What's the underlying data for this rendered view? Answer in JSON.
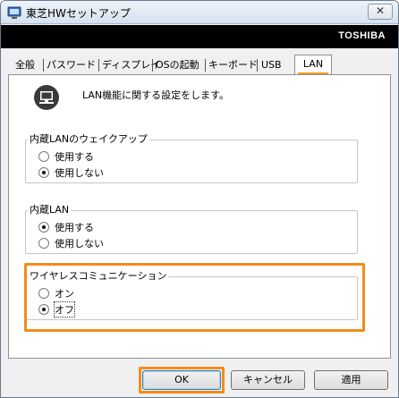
{
  "window": {
    "title": "東芝HWセットアップ",
    "close_glyph": "✕",
    "brand": "TOSHIBA"
  },
  "tabs": [
    {
      "label": "全般"
    },
    {
      "label": "パスワード"
    },
    {
      "label": "ディスプレイ"
    },
    {
      "label": "OSの起動"
    },
    {
      "label": "キーボード"
    },
    {
      "label": "USB"
    },
    {
      "label": "LAN",
      "active": true
    }
  ],
  "panel": {
    "icon": "computer-network-icon",
    "description": "LAN機能に関する設定をします。"
  },
  "groups": {
    "wol": {
      "title": "内蔵LANのウェイクアップ",
      "options": [
        {
          "label": "使用する",
          "checked": false
        },
        {
          "label": "使用しない",
          "checked": true
        }
      ]
    },
    "lan": {
      "title": "内蔵LAN",
      "options": [
        {
          "label": "使用する",
          "checked": true
        },
        {
          "label": "使用しない",
          "checked": false
        }
      ]
    },
    "wireless": {
      "title": "ワイヤレスコミュニケーション",
      "options": [
        {
          "label": "オン",
          "checked": false
        },
        {
          "label": "オフ",
          "checked": true
        }
      ]
    }
  },
  "buttons": {
    "ok": "OK",
    "cancel": "キャンセル",
    "apply": "適用"
  },
  "colors": {
    "highlight": "#f28c1b",
    "brand_bg": "#000000",
    "brand_fg": "#ffffff"
  }
}
